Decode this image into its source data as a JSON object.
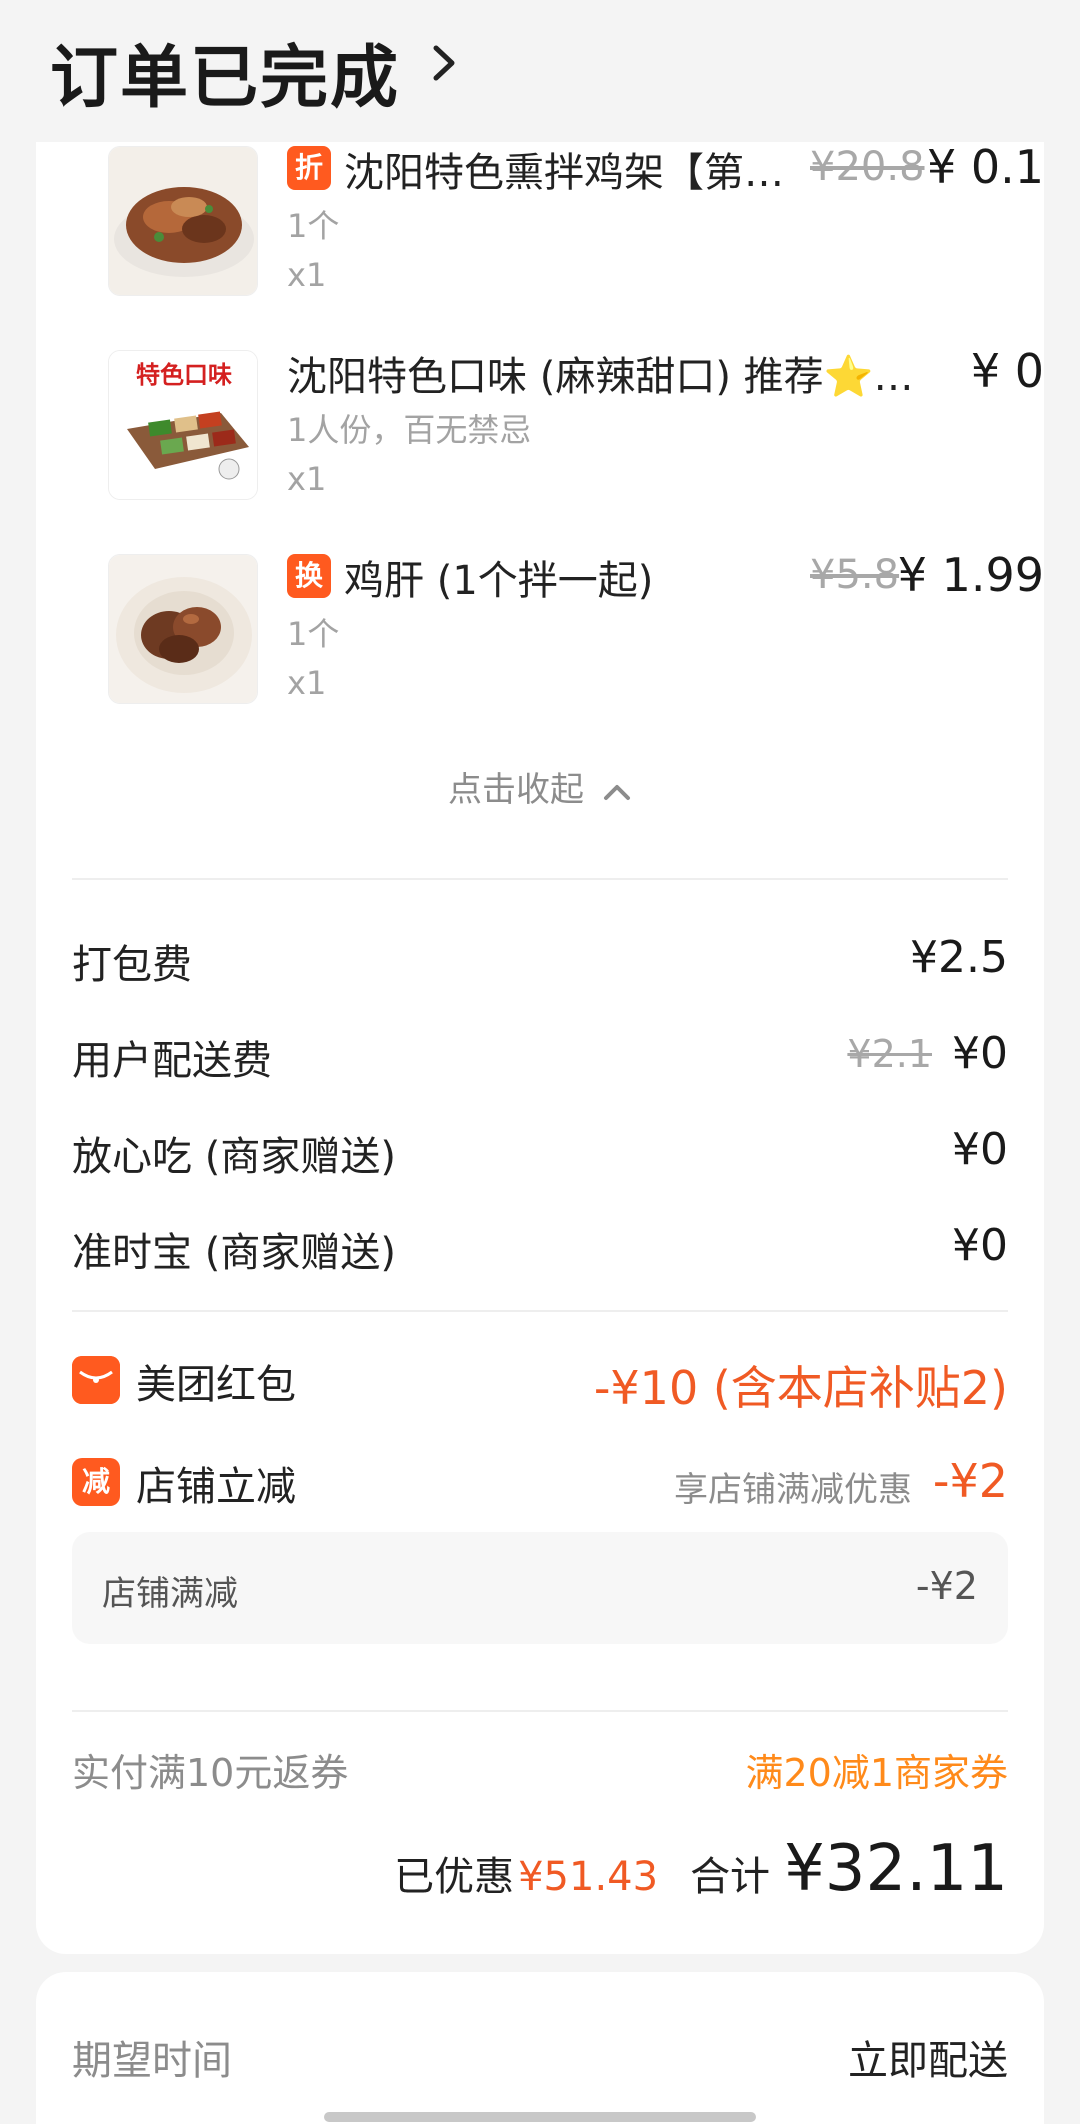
{
  "header": {
    "title": "订单已完成"
  },
  "items": [
    {
      "badge": "折",
      "name": "沈阳特色熏拌鸡架【第…",
      "sub": "1个",
      "qty": "x1",
      "original_price": "¥20.8",
      "price": "¥ 0.1"
    },
    {
      "badge": "",
      "name": "沈阳特色口味 (麻辣甜口) 推荐⭐…",
      "sub": "1人份，百无禁忌",
      "qty": "x1",
      "original_price": "",
      "price": "¥ 0"
    },
    {
      "badge": "换",
      "name": "鸡肝 (1个拌一起)",
      "sub": "1个",
      "qty": "x1",
      "original_price": "¥5.8",
      "price": "¥ 1.99"
    }
  ],
  "collapse_label": "点击收起",
  "fees": [
    {
      "label": "打包费",
      "original": "",
      "value": "¥2.5"
    },
    {
      "label": "用户配送费",
      "original": "¥2.1",
      "value": "¥0"
    },
    {
      "label": "放心吃 (商家赠送)",
      "original": "",
      "value": "¥0"
    },
    {
      "label": "准时宝 (商家赠送)",
      "original": "",
      "value": "¥0"
    }
  ],
  "promos": {
    "red_packet": {
      "label": "美团红包",
      "value": "-¥10 (含本店补贴2)"
    },
    "shop_discount": {
      "icon_text": "减",
      "label": "店铺立减",
      "note": "享店铺满减优惠",
      "value": "-¥2"
    },
    "sub_detail": {
      "label": "店铺满减",
      "value": "-¥2"
    }
  },
  "coupon": {
    "label": "实付满10元返券",
    "value": "满20减1商家券"
  },
  "totals": {
    "saved_label": "已优惠",
    "saved_value": "¥51.43",
    "sum_label": "合计",
    "sum_value": "¥32.11"
  },
  "delivery": {
    "label": "期望时间",
    "value": "立即配送"
  },
  "colors": {
    "accent_orange": "#ff5a1f",
    "discount_red": "#f05a24",
    "coupon_orange": "#ff8a1a"
  }
}
